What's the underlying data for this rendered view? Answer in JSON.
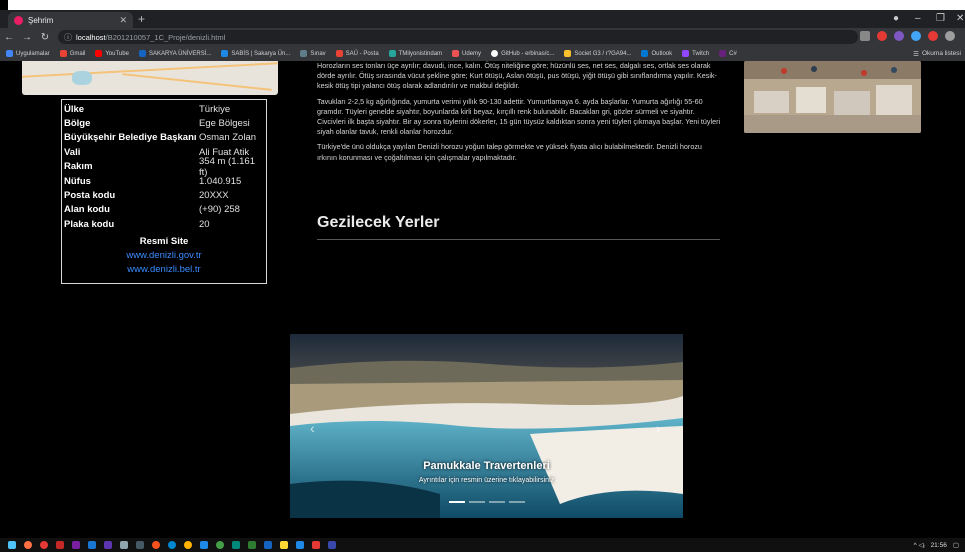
{
  "browser": {
    "tab_title": "Şehrim",
    "new_tab_symbol": "+",
    "url_host": "localhost",
    "url_path": "/B201210057_1C_Proje/denizli.html",
    "bookmarks": [
      "Uygulamalar",
      "Gmail",
      "YouTube",
      "SAKARYA ÜNİVERSİ...",
      "SABİS | Sakarya Ün...",
      "Sınav",
      "SAÜ - Posta",
      "TMilyonistindam",
      "Udemy",
      "GitHub - erbinas/c...",
      "Societ G3 / r?GA94...",
      "Outlook",
      "Twitch",
      "C#"
    ],
    "reading_list": "Okuma listesi",
    "window_controls": [
      "–",
      "❐",
      "✕"
    ]
  },
  "infobox": {
    "rows": [
      {
        "key": "Ülke",
        "value": "Türkiye"
      },
      {
        "key": "Bölge",
        "value": "Ege Bölgesi"
      },
      {
        "key": "Büyükşehir Belediye Başkanı",
        "value": "Osman Zolan"
      },
      {
        "key": "Vali",
        "value": "Ali Fuat Atik"
      },
      {
        "key": "Rakım",
        "value": "354 m (1.161 ft)"
      },
      {
        "key": "Nüfus",
        "value": "1.040.915"
      },
      {
        "key": "Posta kodu",
        "value": "20XXX"
      },
      {
        "key": "Alan kodu",
        "value": "(+90) 258"
      },
      {
        "key": "Plaka kodu",
        "value": "20"
      }
    ],
    "site_heading": "Resmi Site",
    "links": [
      "www.denizli.gov.tr",
      "www.denizli.bel.tr"
    ]
  },
  "article": {
    "paragraphs": [
      "Horozların ses tonları üçe ayrılır; davudi, ince, kalın. Ötüş niteliğine göre; hüzünlü ses, net ses, dalgalı ses, ortlak ses olarak dörde ayrılır. Ötüş sırasında vücut şekline göre; Kurt ötüşü, Aslan ötüşü, pus ötüşü, yiğit ötüşü gibi sınıflandırma yapılır. Kesik-kesik ötüş tipi yalancı ötüş olarak adlandırılır ve makbul değildir.",
      "Tavukları 2-2,5 kg ağırlığında, yumurta verimi yıllık 90-130 adettir. Yumurtlamaya 6. ayda başlarlar. Yumurta ağırlığı 55-60 gramdır. Tüyleri genelde siyahtır, boyunlarda kirli beyaz, kırçıllı renk bulunabilir. Bacakları gri, gözler sürmeli ve siyahtır. Civcivleri ilk başta siyahtır. Bir ay sonra tüylerini dökerler, 15 gün tüysüz kaldıktan sonra yeni tüyleri çıkmaya başlar. Yeni tüyleri siyah olanlar tavuk, renkli olanlar horozdur.",
      "Türkiye'de ünü oldukça yayılan Denizli horozu yoğun talep görmekte ve yüksek fiyata alıcı bulabilmektedir. Denizli horozu ırkının korunması ve çoğaltılması için çalışmalar yapılmaktadır."
    ],
    "section_title": "Gezilecek Yerler"
  },
  "carousel": {
    "title": "Pamukkale Travertenleri",
    "subtitle": "Ayrıntılar için resmin üzerine tıklayabilirsiniz",
    "prev_symbol": "‹",
    "next_symbol": "›",
    "slide_count": 4,
    "active_index": 0
  },
  "taskbar": {
    "tray_time": "21:56",
    "tray_symbols": "^ ◁ᵢ"
  },
  "colors": {
    "link": "#3a8cff",
    "chrome_bg": "#202124",
    "page_bg": "#000000"
  }
}
